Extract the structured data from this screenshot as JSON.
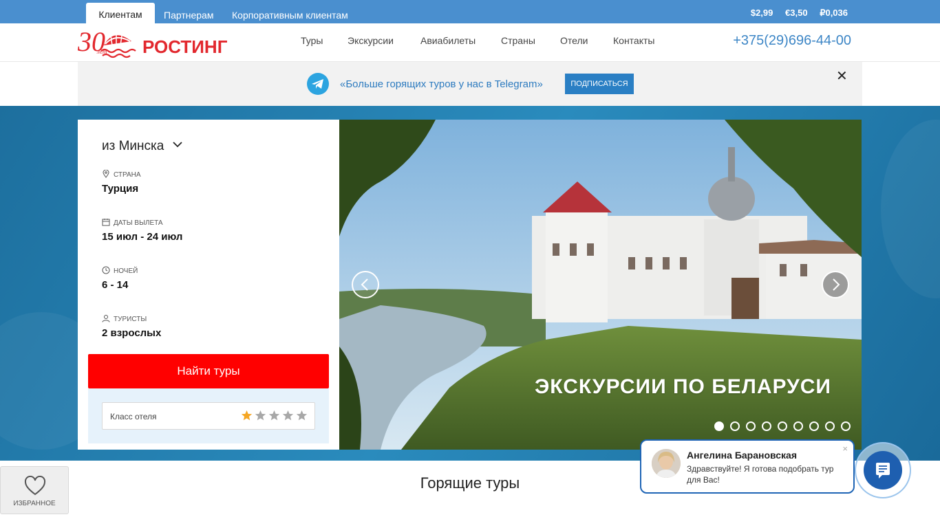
{
  "topbar": {
    "tabs": [
      "Клиентам",
      "Партнерам",
      "Корпоративным клиентам"
    ],
    "rates": [
      "$2,99",
      "€3,50",
      "₽0,036"
    ]
  },
  "header": {
    "logo_text": "РОСТИНГ",
    "logo_years": "30",
    "logo_sub": "лет",
    "nav": [
      "Туры",
      "Экскурсии",
      "Авиабилеты",
      "Страны",
      "Отели",
      "Контакты"
    ],
    "phone": "+375(29)696-44-00"
  },
  "telegram_banner": {
    "text": "«Больше горящих туров у нас в Telegram»",
    "button": "ПОДПИСАТЬСЯ",
    "close": "✕"
  },
  "search": {
    "from": "из Минска",
    "country_label": "Страна",
    "country_value": "Турция",
    "dates_label": "Даты вылета",
    "dates_value": "15 июл - 24 июл",
    "nights_label": "Ночей",
    "nights_value": "6 - 14",
    "tourists_label": "Туристы",
    "tourists_value": "2 взрослых",
    "submit": "Найти туры",
    "hotel_class_label": "Класс отеля",
    "hotel_class_selected": 1,
    "hotel_class_max": 5
  },
  "slider": {
    "caption": "ЭКСКУРСИИ ПО БЕЛАРУСИ",
    "slide_count": 9,
    "active_slide": 1
  },
  "hot_tours_title": "Горящие туры",
  "favorites_label": "ИЗБРАННОЕ",
  "chat": {
    "name": "Ангелина Барановская",
    "message": "Здравствуйте! Я готова подобрать тур для Вас!",
    "close": "×"
  },
  "colors": {
    "topbar": "#4a8fcf",
    "accent_red": "#ff0000",
    "phone_blue": "#3d86c6",
    "chat_blue": "#1e5fb0"
  }
}
